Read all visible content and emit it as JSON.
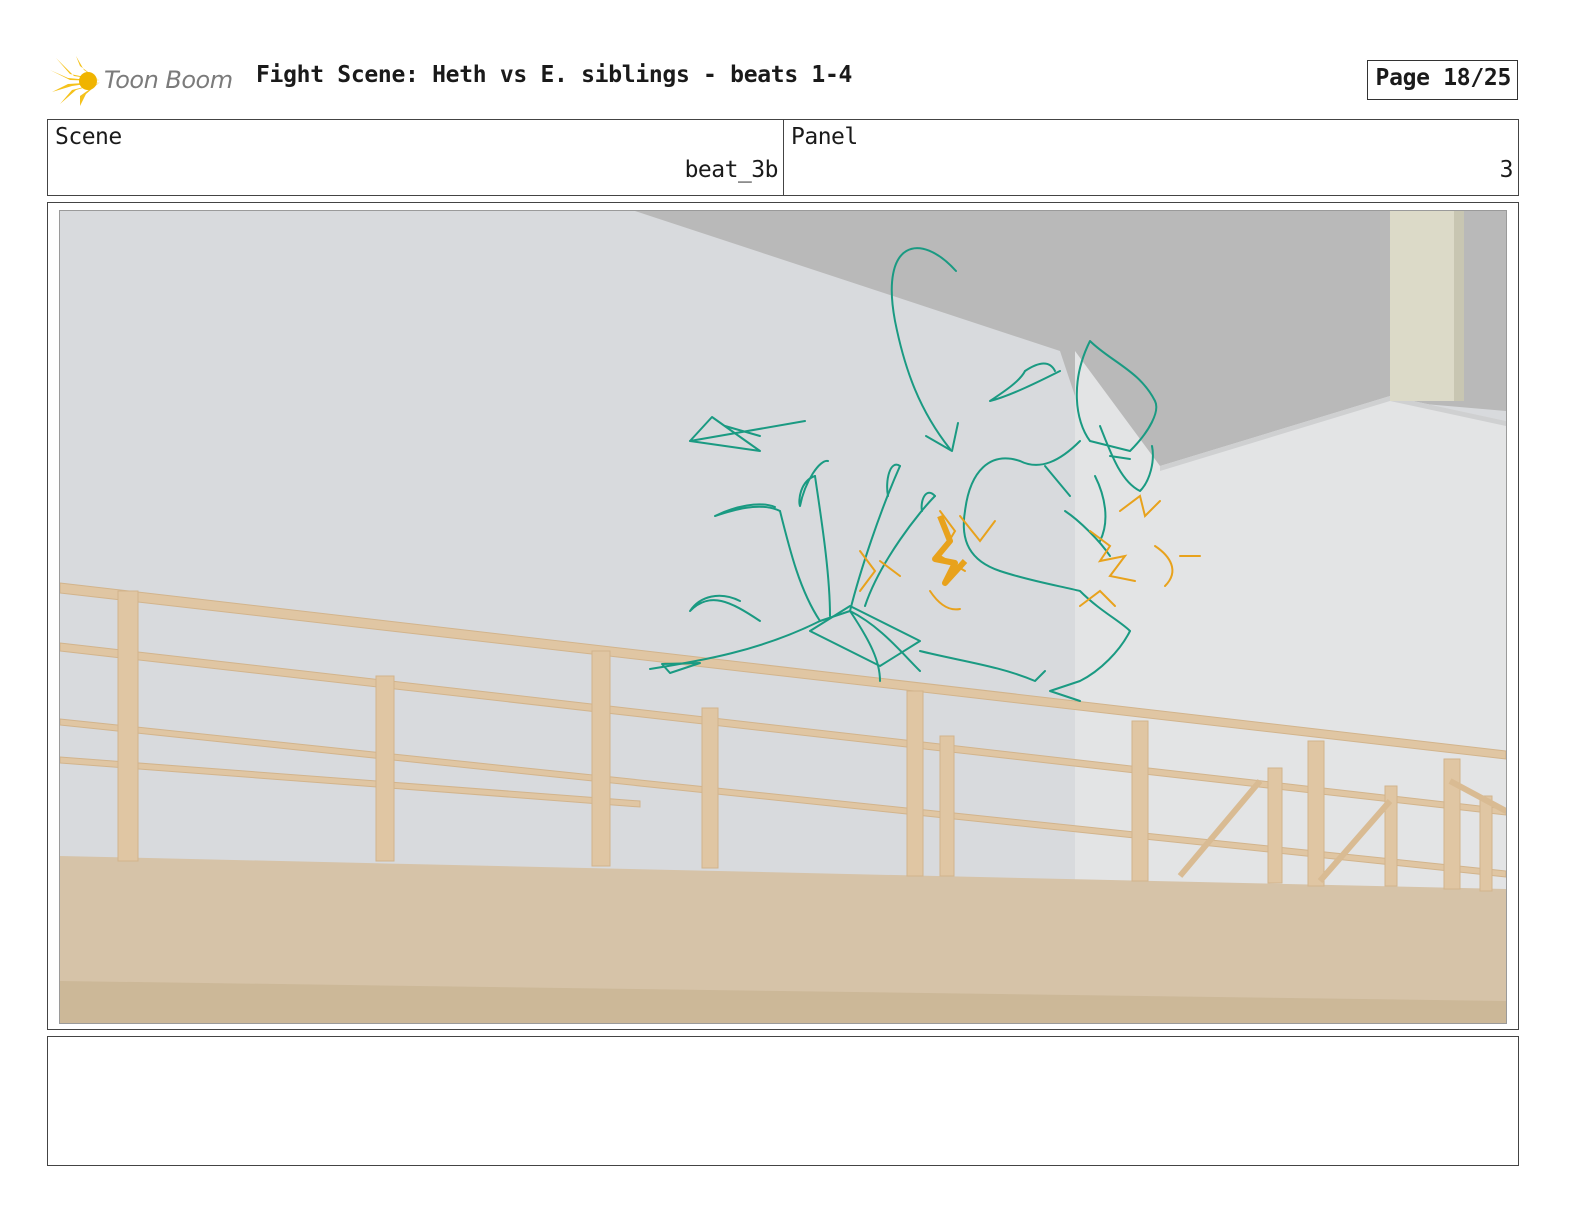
{
  "header": {
    "logo_text": "Toon Boom",
    "title": "Fight Scene: Heth vs E. siblings - beats 1-4",
    "page_label": "Page 18/25"
  },
  "panel_info": {
    "scene_label": "Scene",
    "scene_value": "beat_3b",
    "panel_label": "Panel",
    "panel_value": "3"
  },
  "artwork": {
    "sketch_color": "#1a9a82",
    "impact_color": "#e8a21c",
    "railing_color": "#e2c7a5",
    "wall_color": "#d7d9dc",
    "ceiling_color": "#b8b8b8"
  },
  "notes": {
    "text": ""
  }
}
